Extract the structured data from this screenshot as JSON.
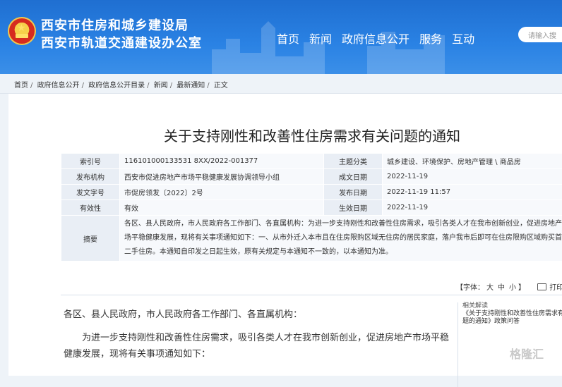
{
  "header": {
    "org_line1": "西安市住房和城乡建设局",
    "org_line2": "西安市轨道交通建设办公室",
    "nav": [
      "首页",
      "新闻",
      "政府信息公开",
      "服务",
      "互动"
    ],
    "search_placeholder": "请输入搜"
  },
  "breadcrumb": [
    "首页",
    "政府信息公开",
    "政府信息公开目录",
    "新闻",
    "最新通知",
    "正文"
  ],
  "article": {
    "title": "关于支持刚性和改善性住房需求有关问题的通知",
    "meta": {
      "index_label": "索引号",
      "index_value": "116101000133531 8XX/2022-001377",
      "topic_label": "主题分类",
      "topic_value": "城乡建设、环境保护、房地产管理 \\ 商品房",
      "issuer_label": "发布机构",
      "issuer_value": "西安市促进房地产市场平稳健康发展协调领导小组",
      "created_label": "成文日期",
      "created_value": "2022-11-19",
      "docno_label": "发文字号",
      "docno_value": "市促房领发〔2022〕2号",
      "published_label": "发布日期",
      "published_value": "2022-11-19 11:57",
      "validity_label": "有效性",
      "validity_value": "有效",
      "effective_label": "生效日期",
      "effective_value": "2022-11-19",
      "summary_label": "摘要",
      "summary_value": "各区、县人民政府，市人民政府各工作部门、各直属机构：为进一步支持刚性和改善性住房需求，吸引各类人才在我市创新创业，促进房地产市场平稳健康发展，现将有关事项通知如下：一、从市外迁入本市且在住房限购区域无住房的居民家庭，落户我市后即可在住房限购区域购买首套二手住房。本通知自印发之日起生效，原有关规定与本通知不一致的，以本通知为准。"
    },
    "tools": {
      "font_label": "【字体：",
      "size_large": "大",
      "size_medium": "中",
      "size_small": "小",
      "font_close": "】",
      "print_label": "打印"
    },
    "body_salutation": "各区、县人民政府，市人民政府各工作部门、各直属机构：",
    "body_para1": "为进一步支持刚性和改善性住房需求，吸引各类人才在我市创新创业，促进房地产市场平稳健康发展，现将有关事项通知如下：",
    "related_title": "相关解读",
    "related_link": "《关于支持刚性和改善性住房需求有关问题的通知》政策问答"
  },
  "watermark": "格隆汇"
}
